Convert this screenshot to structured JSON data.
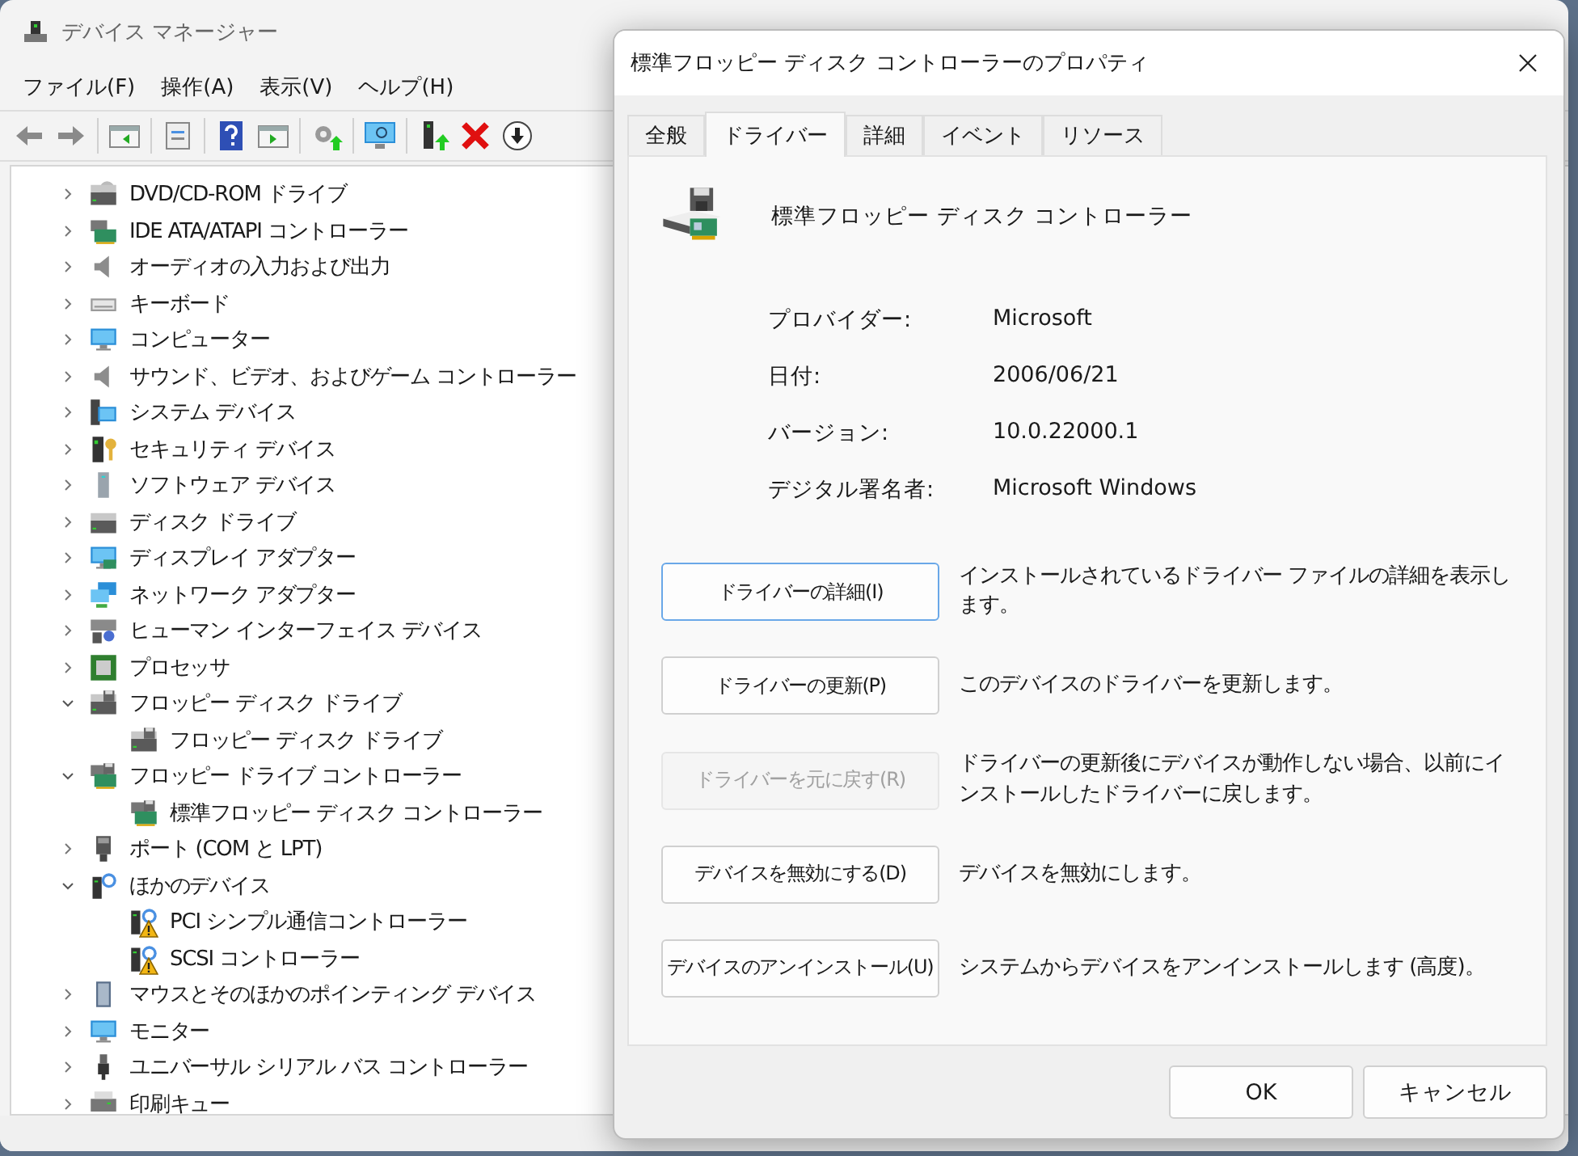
{
  "window": {
    "title": "デバイス マネージャー"
  },
  "menu": [
    {
      "label": "ファイル(F)"
    },
    {
      "label": "操作(A)"
    },
    {
      "label": "表示(V)"
    },
    {
      "label": "ヘルプ(H)"
    }
  ],
  "tree": [
    {
      "label": "DVD/CD-ROM ドライブ",
      "expanded": false
    },
    {
      "label": "IDE ATA/ATAPI コントローラー",
      "expanded": false
    },
    {
      "label": "オーディオの入力および出力",
      "expanded": false
    },
    {
      "label": "キーボード",
      "expanded": false
    },
    {
      "label": "コンピューター",
      "expanded": false
    },
    {
      "label": "サウンド、ビデオ、およびゲーム コントローラー",
      "expanded": false
    },
    {
      "label": "システム デバイス",
      "expanded": false
    },
    {
      "label": "セキュリティ デバイス",
      "expanded": false
    },
    {
      "label": "ソフトウェア デバイス",
      "expanded": false
    },
    {
      "label": "ディスク ドライブ",
      "expanded": false
    },
    {
      "label": "ディスプレイ アダプター",
      "expanded": false
    },
    {
      "label": "ネットワーク アダプター",
      "expanded": false
    },
    {
      "label": "ヒューマン インターフェイス デバイス",
      "expanded": false
    },
    {
      "label": "プロセッサ",
      "expanded": false
    },
    {
      "label": "フロッピー ディスク ドライブ",
      "expanded": true,
      "children": [
        {
          "label": "フロッピー ディスク ドライブ",
          "problem": false
        }
      ]
    },
    {
      "label": "フロッピー ドライブ コントローラー",
      "expanded": true,
      "children": [
        {
          "label": "標準フロッピー ディスク コントローラー",
          "problem": false
        }
      ]
    },
    {
      "label": "ポート (COM と LPT)",
      "expanded": false
    },
    {
      "label": "ほかのデバイス",
      "expanded": true,
      "children": [
        {
          "label": "PCI シンプル通信コントローラー",
          "problem": true
        },
        {
          "label": "SCSI コントローラー",
          "problem": true
        }
      ]
    },
    {
      "label": "マウスとそのほかのポインティング デバイス",
      "expanded": false
    },
    {
      "label": "モニター",
      "expanded": false
    },
    {
      "label": "ユニバーサル シリアル バス コントローラー",
      "expanded": false
    },
    {
      "label": "印刷キュー",
      "expanded": false
    }
  ],
  "dialog": {
    "title": "標準フロッピー ディスク コントローラーのプロパティ",
    "tabs": [
      {
        "label": "全般",
        "selected": false
      },
      {
        "label": "ドライバー",
        "selected": true
      },
      {
        "label": "詳細",
        "selected": false
      },
      {
        "label": "イベント",
        "selected": false
      },
      {
        "label": "リソース",
        "selected": false
      }
    ],
    "device_name": "標準フロッピー ディスク コントローラー",
    "fields": [
      {
        "label": "プロバイダー:",
        "value": "Microsoft"
      },
      {
        "label": "日付:",
        "value": "2006/06/21"
      },
      {
        "label": "バージョン:",
        "value": "10.0.22000.1"
      },
      {
        "label": "デジタル署名者:",
        "value": "Microsoft Windows"
      }
    ],
    "actions": [
      {
        "button": "ドライバーの詳細(I)",
        "description": "インストールされているドライバー ファイルの詳細を表示します。",
        "disabled": false,
        "focused": true
      },
      {
        "button": "ドライバーの更新(P)",
        "description": "このデバイスのドライバーを更新します。",
        "disabled": false,
        "focused": false
      },
      {
        "button": "ドライバーを元に戻す(R)",
        "description": "ドライバーの更新後にデバイスが動作しない場合、以前にインストールしたドライバーに戻します。",
        "disabled": true,
        "focused": false
      },
      {
        "button": "デバイスを無効にする(D)",
        "description": "デバイスを無効にします。",
        "disabled": false,
        "focused": false
      },
      {
        "button": "デバイスのアンインストール(U)",
        "description": "システムからデバイスをアンインストールします (高度)。",
        "disabled": false,
        "focused": false
      }
    ],
    "buttons": [
      {
        "label": "OK"
      },
      {
        "label": "キャンセル"
      }
    ]
  }
}
